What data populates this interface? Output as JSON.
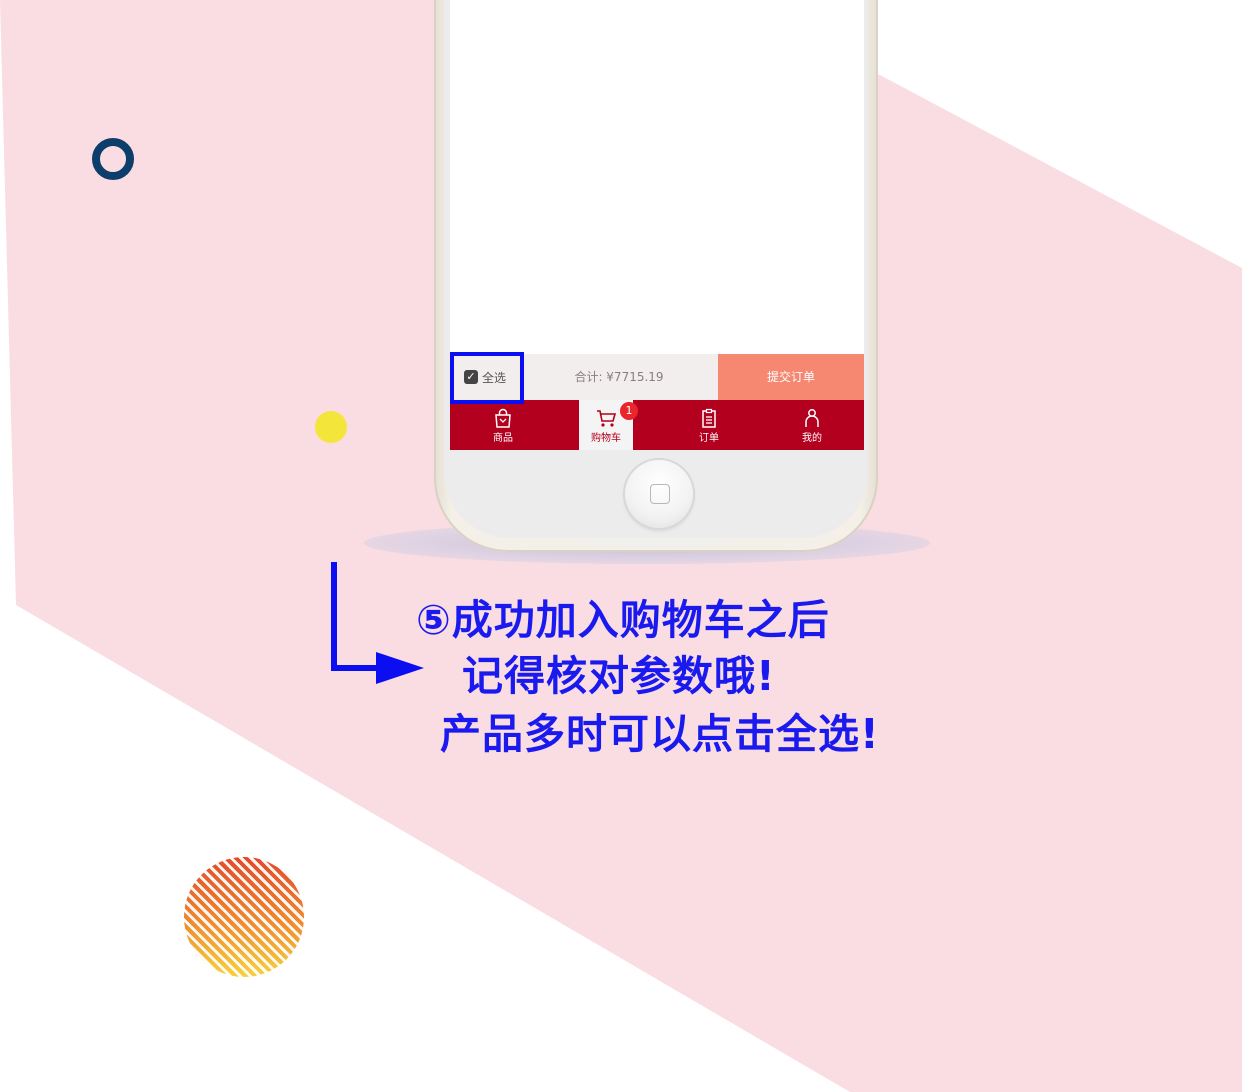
{
  "colors": {
    "background_pink": "#f9dde2",
    "accent_blue": "#0b0ef0",
    "tabbar_red": "#b3001e",
    "submit_salmon": "#f68872",
    "ring_navy": "#0d3d6b",
    "dot_yellow": "#f3e53a"
  },
  "cart_bar": {
    "select_all_label": "全选",
    "total_label": "合计: ¥7715.19",
    "submit_label": "提交订单"
  },
  "tabbar": {
    "tabs": [
      {
        "label": "商品",
        "icon": "shopping-bag-icon"
      },
      {
        "label": "购物车",
        "icon": "cart-icon",
        "badge": "1",
        "active": true
      },
      {
        "label": "订单",
        "icon": "clipboard-icon"
      },
      {
        "label": "我的",
        "icon": "person-icon"
      }
    ]
  },
  "caption": {
    "line1": "⑤成功加入购物车之后",
    "line2": "记得核对参数哦!",
    "line3": "产品多时可以点击全选!"
  }
}
